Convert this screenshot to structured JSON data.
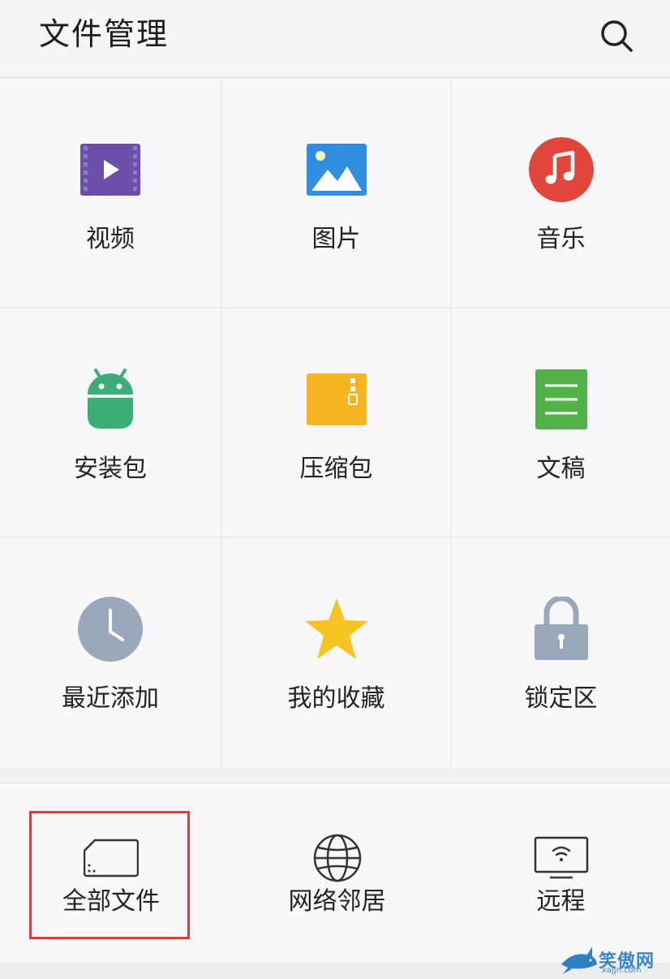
{
  "header": {
    "title": "文件管理",
    "search_icon": "search-icon"
  },
  "categories": [
    {
      "label": "视频",
      "icon": "video-icon",
      "color": "#6b4fa8"
    },
    {
      "label": "图片",
      "icon": "image-icon",
      "color": "#2f8ee0"
    },
    {
      "label": "音乐",
      "icon": "music-icon",
      "color": "#e2453a"
    },
    {
      "label": "安装包",
      "icon": "android-icon",
      "color": "#3cad75"
    },
    {
      "label": "压缩包",
      "icon": "archive-icon",
      "color": "#f6b51e"
    },
    {
      "label": "文稿",
      "icon": "document-icon",
      "color": "#52b148"
    },
    {
      "label": "最近添加",
      "icon": "clock-icon",
      "color": "#9aa8bb"
    },
    {
      "label": "我的收藏",
      "icon": "star-icon",
      "color": "#f7c321"
    },
    {
      "label": "锁定区",
      "icon": "lock-icon",
      "color": "#9aa8bb"
    }
  ],
  "bottom_items": [
    {
      "label": "全部文件",
      "icon": "storage-card-icon"
    },
    {
      "label": "网络邻居",
      "icon": "globe-icon"
    },
    {
      "label": "远程",
      "icon": "remote-screen-icon"
    }
  ],
  "highlight_color": "#e23a3a",
  "watermark": {
    "text": "笑傲网",
    "sub": "xajjn.com"
  }
}
